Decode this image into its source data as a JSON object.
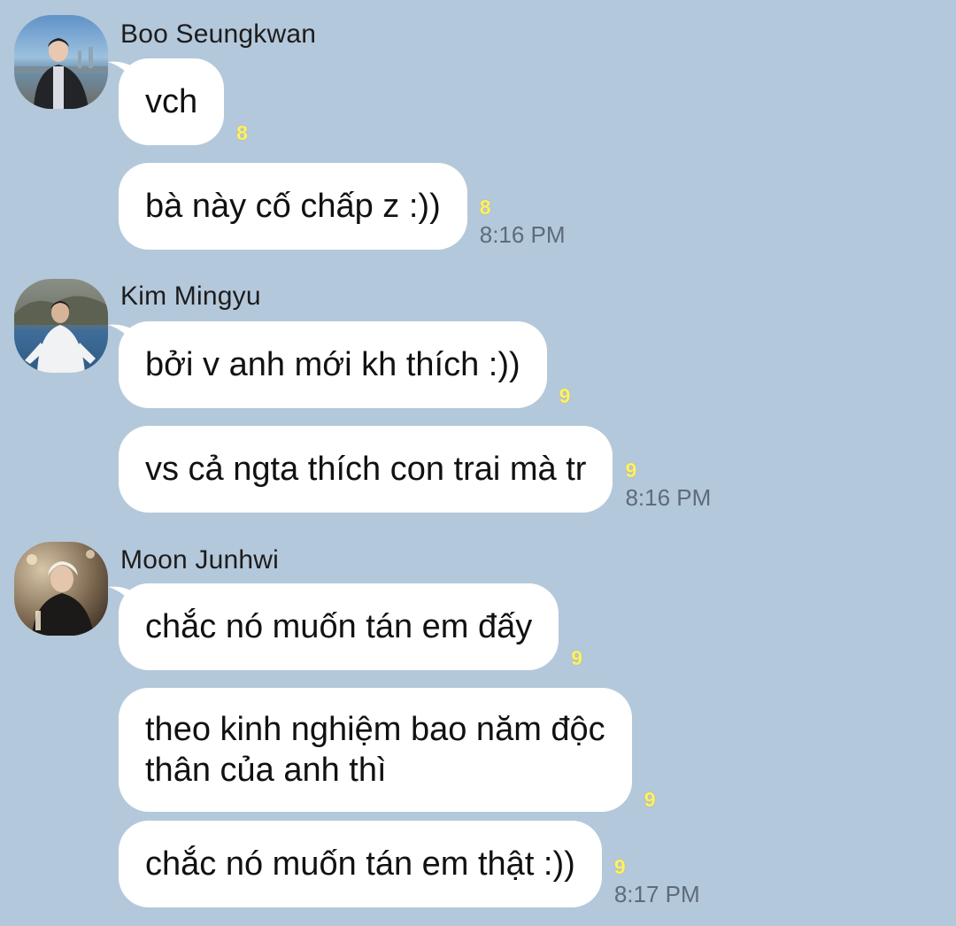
{
  "colors": {
    "background": "#b4c8db",
    "bubble": "#ffffff",
    "unread_count": "#fff06a",
    "timestamp": "#5d6b7a"
  },
  "groups": [
    {
      "sender": "Boo Seungkwan",
      "avatar_icon": "avatar-photo-icon",
      "messages": [
        {
          "text": "vch",
          "unread": "8",
          "time": ""
        },
        {
          "text": "bà này cố chấp z :))",
          "unread": "8",
          "time": "8:16 PM"
        }
      ]
    },
    {
      "sender": "Kim Mingyu",
      "avatar_icon": "avatar-photo-icon",
      "messages": [
        {
          "text": "bởi v anh mới kh thích :))",
          "unread": "9",
          "time": ""
        },
        {
          "text": "vs cả ngta thích con trai mà tr",
          "unread": "9",
          "time": "8:16 PM"
        }
      ]
    },
    {
      "sender": "Moon Junhwi",
      "avatar_icon": "avatar-photo-icon",
      "messages": [
        {
          "text": "chắc nó muốn tán em đấy",
          "unread": "9",
          "time": ""
        },
        {
          "text": "theo kinh nghiệm bao năm độc thân của anh thì",
          "line1": "theo kinh nghiệm bao năm độc",
          "line2": "thân của anh thì",
          "unread": "9",
          "time": ""
        },
        {
          "text": "chắc nó muốn tán em thật :))",
          "unread": "9",
          "time": "8:17 PM"
        }
      ]
    }
  ]
}
